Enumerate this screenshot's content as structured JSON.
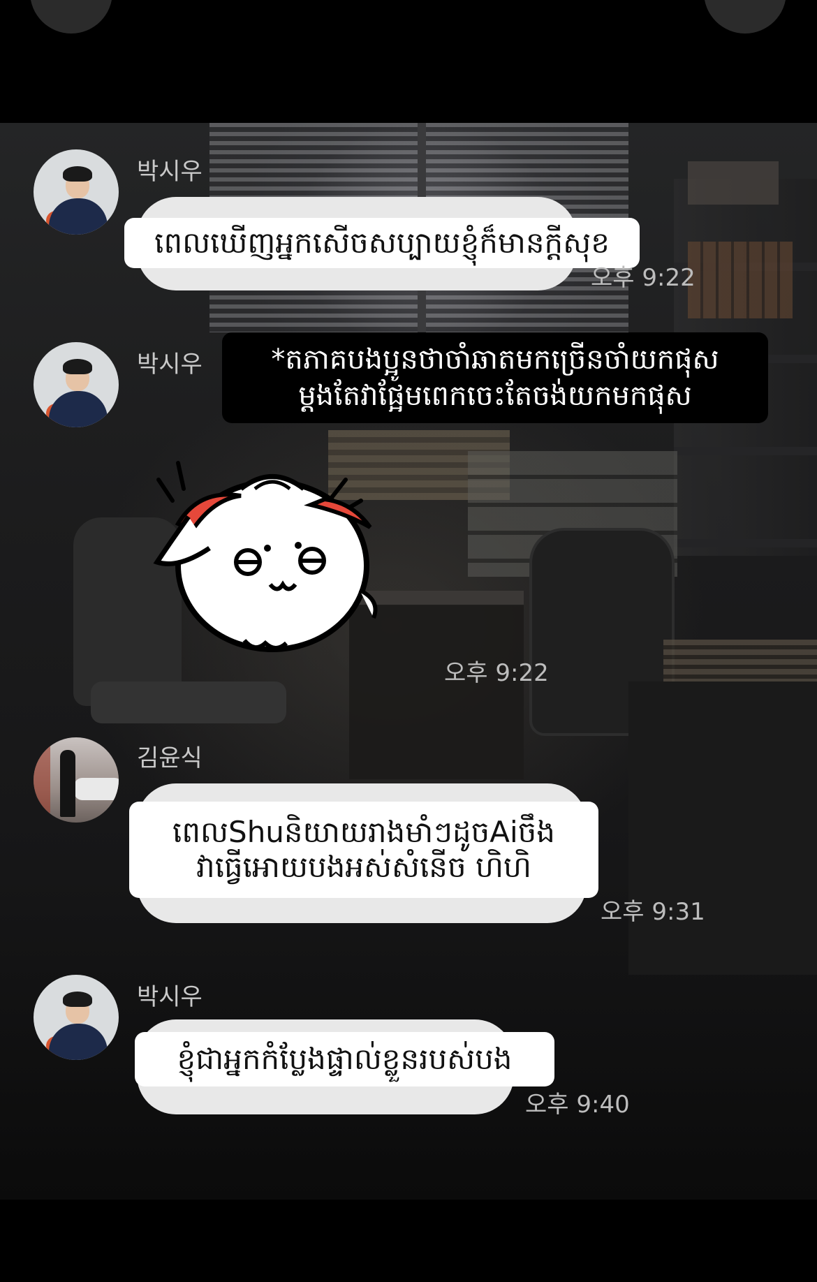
{
  "top_bar": {
    "back_icon": "chevron-left-icon",
    "menu_icon": "circle-button-icon"
  },
  "messages": [
    {
      "sender": "박시우",
      "text": "ពេលឃើញអ្នកសើចសប្បាយខ្ញុំក៏មានក្ដីសុខ",
      "time": "오후 9:22"
    },
    {
      "sender": "박시우",
      "caption": "*តភាគបងប្អូនថាចាំឆាតមកច្រើនចាំយកផុស\nម្ដងតែវាផ្អែមពេកចេះតែចង់យកមកផុស",
      "sticker": "saluting-dumpling-sticker",
      "time": "오후 9:22"
    },
    {
      "sender": "김윤식",
      "text": "ពេលShuនិយាយរាងមាំៗដូចAiចឹង\nវាធ្វើអោយបងអស់សំនើច ហិហិ",
      "time": "오후 9:31"
    },
    {
      "sender": "박시우",
      "text": "ខ្ញុំជាអ្នកកំប្លែងផ្ទាល់ខ្លួនរបស់បង",
      "time": "오후 9:40"
    }
  ]
}
